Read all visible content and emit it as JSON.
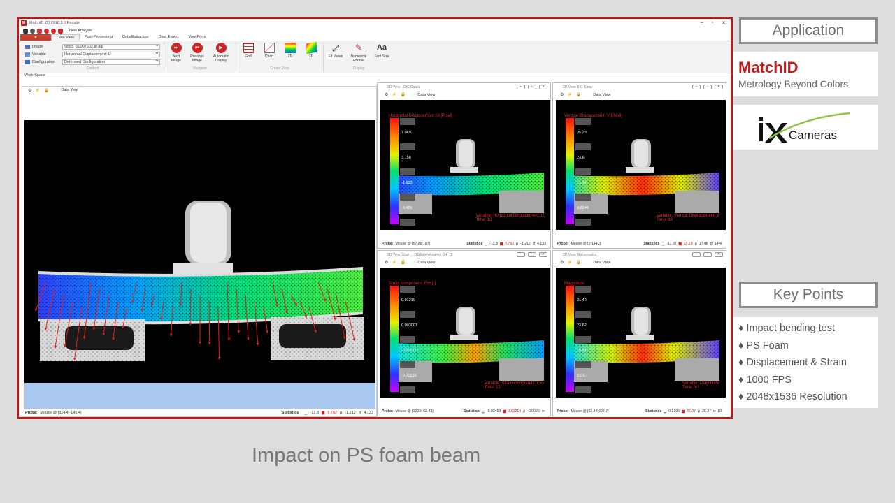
{
  "app": {
    "title": "MatchID 2D 2018.1.0 Results",
    "logo_text": "M",
    "window_controls": {
      "min": "–",
      "max": "▫",
      "close": "✕"
    },
    "quick_access": {
      "new_analysis": "New Analysis"
    },
    "tabs": [
      "Data View",
      "Post-Processing",
      "Data Extraction",
      "Data Export",
      "ViewPorts"
    ],
    "active_tab": "Data View",
    "ribbon": {
      "content": {
        "label": "Content",
        "image_label": "Image",
        "image_value": "\\test5_00007602.tif.dat",
        "variable_label": "Variable",
        "variable_value": "Horizontal Displacement: U",
        "config_label": "Configuration",
        "config_value": "Deformed Configuration"
      },
      "navigate": {
        "label": "Navigate",
        "next": "Next Image",
        "previous": "Previous Image",
        "automatic": "Automatic Display"
      },
      "create_view": {
        "label": "Create View",
        "grid": "Grid",
        "chart": "Chart",
        "2d": "2D",
        "3d": "3D"
      },
      "display": {
        "label": "Display",
        "fit": "Fit Views",
        "numerical": "Numerical Format",
        "font": "Font Size",
        "font_glyph": "Aa"
      }
    },
    "workspace": {
      "label": "Work Space",
      "data_view": "Data View",
      "probe_label": "Probe:",
      "probe_value": "Mouse @ [824.4;-145.4]",
      "stats_label": "Statistics",
      "min": "-12.8",
      "max": "9.792",
      "mean": "-1.212",
      "std": "4.133"
    },
    "panels": [
      {
        "title": "2D View - DIC Data1",
        "data_view": "Data View",
        "var_label": "Horizontal Displacement: U [Pixel]",
        "ticks": [
          "7.949",
          "3.156",
          "-1.633",
          "-6.425",
          "-11.22"
        ],
        "overlay1": "Variable: Horizontal Displacement: U",
        "overlay2": "Time: 12",
        "probe": "Mouse @ [57.88;187]",
        "min": "-12.8",
        "max": "9.792",
        "mean": "-1.212",
        "std": "4.133"
      },
      {
        "title": "2D View DIC Data",
        "data_view": "Data View",
        "var_label": "Vertical Displacement: V [Pixel]",
        "ticks": [
          "35.28",
          "23.6",
          "11.94",
          "0.2844",
          "-11.37"
        ],
        "overlay1": "Variable: Vertical Displacement: V",
        "overlay2": "Time: 13",
        "probe": "Mouse @ [0;1443]",
        "min": "-11.37",
        "max": "35.26",
        "mean": "17.48",
        "std": "14.4"
      },
      {
        "title": "2D View Strain_LOGEulerAlmansi_Q4_15",
        "data_view": "Data View",
        "var_label": "Strain component: Exx [ ]",
        "ticks": [
          "0.01219",
          "0.003007",
          "-0.006172",
          "-0.01535",
          "-0.02453"
        ],
        "overlay1": "Variable: Strain component: Exx",
        "overlay2": "Time: 13",
        "probe": "Mouse @ [1202;-53.43]",
        "min": "-0.02453",
        "max": "0.01219",
        "mean": "-0.0026",
        "std": ""
      },
      {
        "title": "2D View Mathematics",
        "data_view": "Data View",
        "var_label": "Magnitude",
        "ticks": [
          "31.42",
          "23.62",
          "15.81",
          "8.011",
          "0.2071"
        ],
        "overlay1": "Variable: Magnitude",
        "overlay2": "Time: 12",
        "probe": "Mouse @ [53.43;302.7]",
        "min": "0.2796",
        "max": "35.27",
        "mean": "20.37",
        "std": "10"
      }
    ]
  },
  "sidebar": {
    "application_heading": "Application",
    "brand_name": "MatchID",
    "brand_tagline": "Metrology Beyond Colors",
    "camera_brand": "Cameras",
    "key_points_heading": "Key Points",
    "key_points": [
      "♦ Impact bending test",
      "♦ PS Foam",
      "♦ Displacement & Strain",
      "♦ 1000 FPS",
      "♦ 2048x1536 Resolution"
    ]
  },
  "caption": "Impact on PS foam beam",
  "colors": {
    "accent": "#b11c1c",
    "brand_red": "#c21d1d",
    "panel_text_red": "#c62424",
    "sidebar_border": "#8c8c8c"
  }
}
